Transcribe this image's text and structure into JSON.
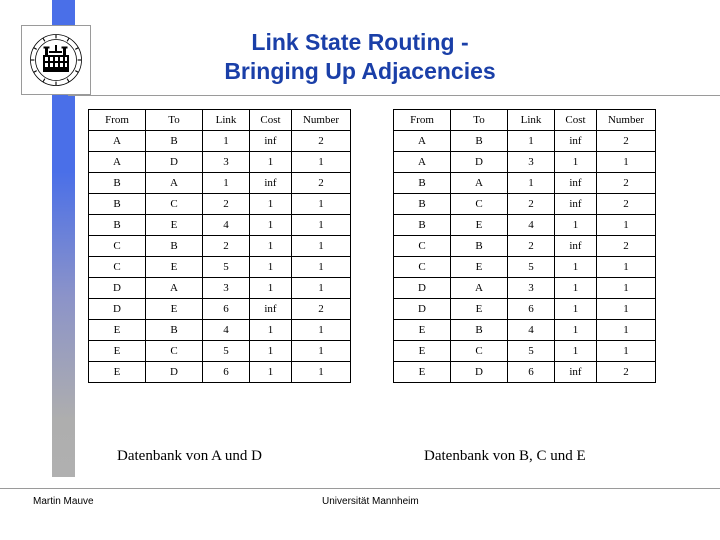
{
  "slide": {
    "title_line1": "Link State Routing -",
    "title_line2": "Bringing Up Adjacencies",
    "title_color": "#1a3fa8",
    "accent_color": "#4a6fe8",
    "rule_color": "#9a9a9a"
  },
  "logo": {
    "icon": "university-seal-icon",
    "alt": "Universität Mannheim seal"
  },
  "tables": {
    "columns": [
      "From",
      "To",
      "Link",
      "Cost",
      "Number"
    ],
    "left": {
      "caption": "Datenbank von A und D",
      "rows": [
        [
          "A",
          "B",
          "1",
          "inf",
          "2"
        ],
        [
          "A",
          "D",
          "3",
          "1",
          "1"
        ],
        [
          "B",
          "A",
          "1",
          "inf",
          "2"
        ],
        [
          "B",
          "C",
          "2",
          "1",
          "1"
        ],
        [
          "B",
          "E",
          "4",
          "1",
          "1"
        ],
        [
          "C",
          "B",
          "2",
          "1",
          "1"
        ],
        [
          "C",
          "E",
          "5",
          "1",
          "1"
        ],
        [
          "D",
          "A",
          "3",
          "1",
          "1"
        ],
        [
          "D",
          "E",
          "6",
          "inf",
          "2"
        ],
        [
          "E",
          "B",
          "4",
          "1",
          "1"
        ],
        [
          "E",
          "C",
          "5",
          "1",
          "1"
        ],
        [
          "E",
          "D",
          "6",
          "1",
          "1"
        ]
      ]
    },
    "right": {
      "caption": "Datenbank von B, C und E",
      "rows": [
        [
          "A",
          "B",
          "1",
          "inf",
          "2"
        ],
        [
          "A",
          "D",
          "3",
          "1",
          "1"
        ],
        [
          "B",
          "A",
          "1",
          "inf",
          "2"
        ],
        [
          "B",
          "C",
          "2",
          "inf",
          "2"
        ],
        [
          "B",
          "E",
          "4",
          "1",
          "1"
        ],
        [
          "C",
          "B",
          "2",
          "inf",
          "2"
        ],
        [
          "C",
          "E",
          "5",
          "1",
          "1"
        ],
        [
          "D",
          "A",
          "3",
          "1",
          "1"
        ],
        [
          "D",
          "E",
          "6",
          "1",
          "1"
        ],
        [
          "E",
          "B",
          "4",
          "1",
          "1"
        ],
        [
          "E",
          "C",
          "5",
          "1",
          "1"
        ],
        [
          "E",
          "D",
          "6",
          "inf",
          "2"
        ]
      ]
    }
  },
  "footer": {
    "author": "Martin Mauve",
    "organization": "Universität Mannheim"
  }
}
